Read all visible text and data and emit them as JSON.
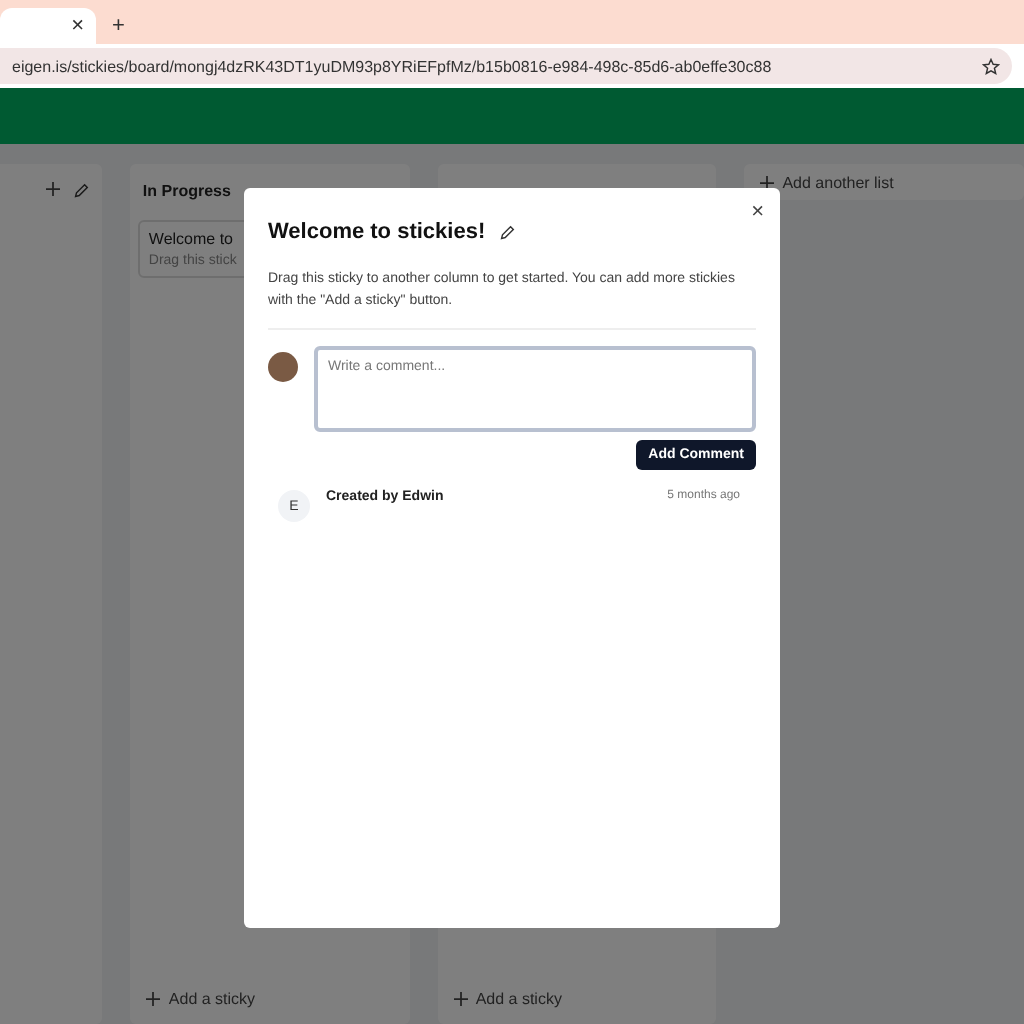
{
  "browser": {
    "tab_close": "×",
    "new_tab": "+",
    "url": "eigen.is/stickies/board/mongj4dzRK43DT1yuDM93p8YRiEFpfMz/b15b0816-e984-498c-85d6-ab0effe30c88"
  },
  "board": {
    "columns": [
      {},
      {
        "title": "In Progress",
        "cards": [
          {
            "title": "Welcome to",
            "text": "Drag this stick"
          }
        ],
        "add_label": "Add a sticky"
      },
      {
        "add_label": "Add a sticky"
      }
    ],
    "add_list": "Add another list"
  },
  "modal": {
    "close": "×",
    "title": "Welcome to stickies!",
    "description": "Drag this sticky to another column to get started. You can add more stickies with the \"Add a sticky\" button.",
    "comment_placeholder": "Write a comment...",
    "submit": "Add Comment",
    "activity": [
      {
        "initial": "E",
        "text": "Created by Edwin",
        "time": "5 months ago"
      }
    ]
  }
}
